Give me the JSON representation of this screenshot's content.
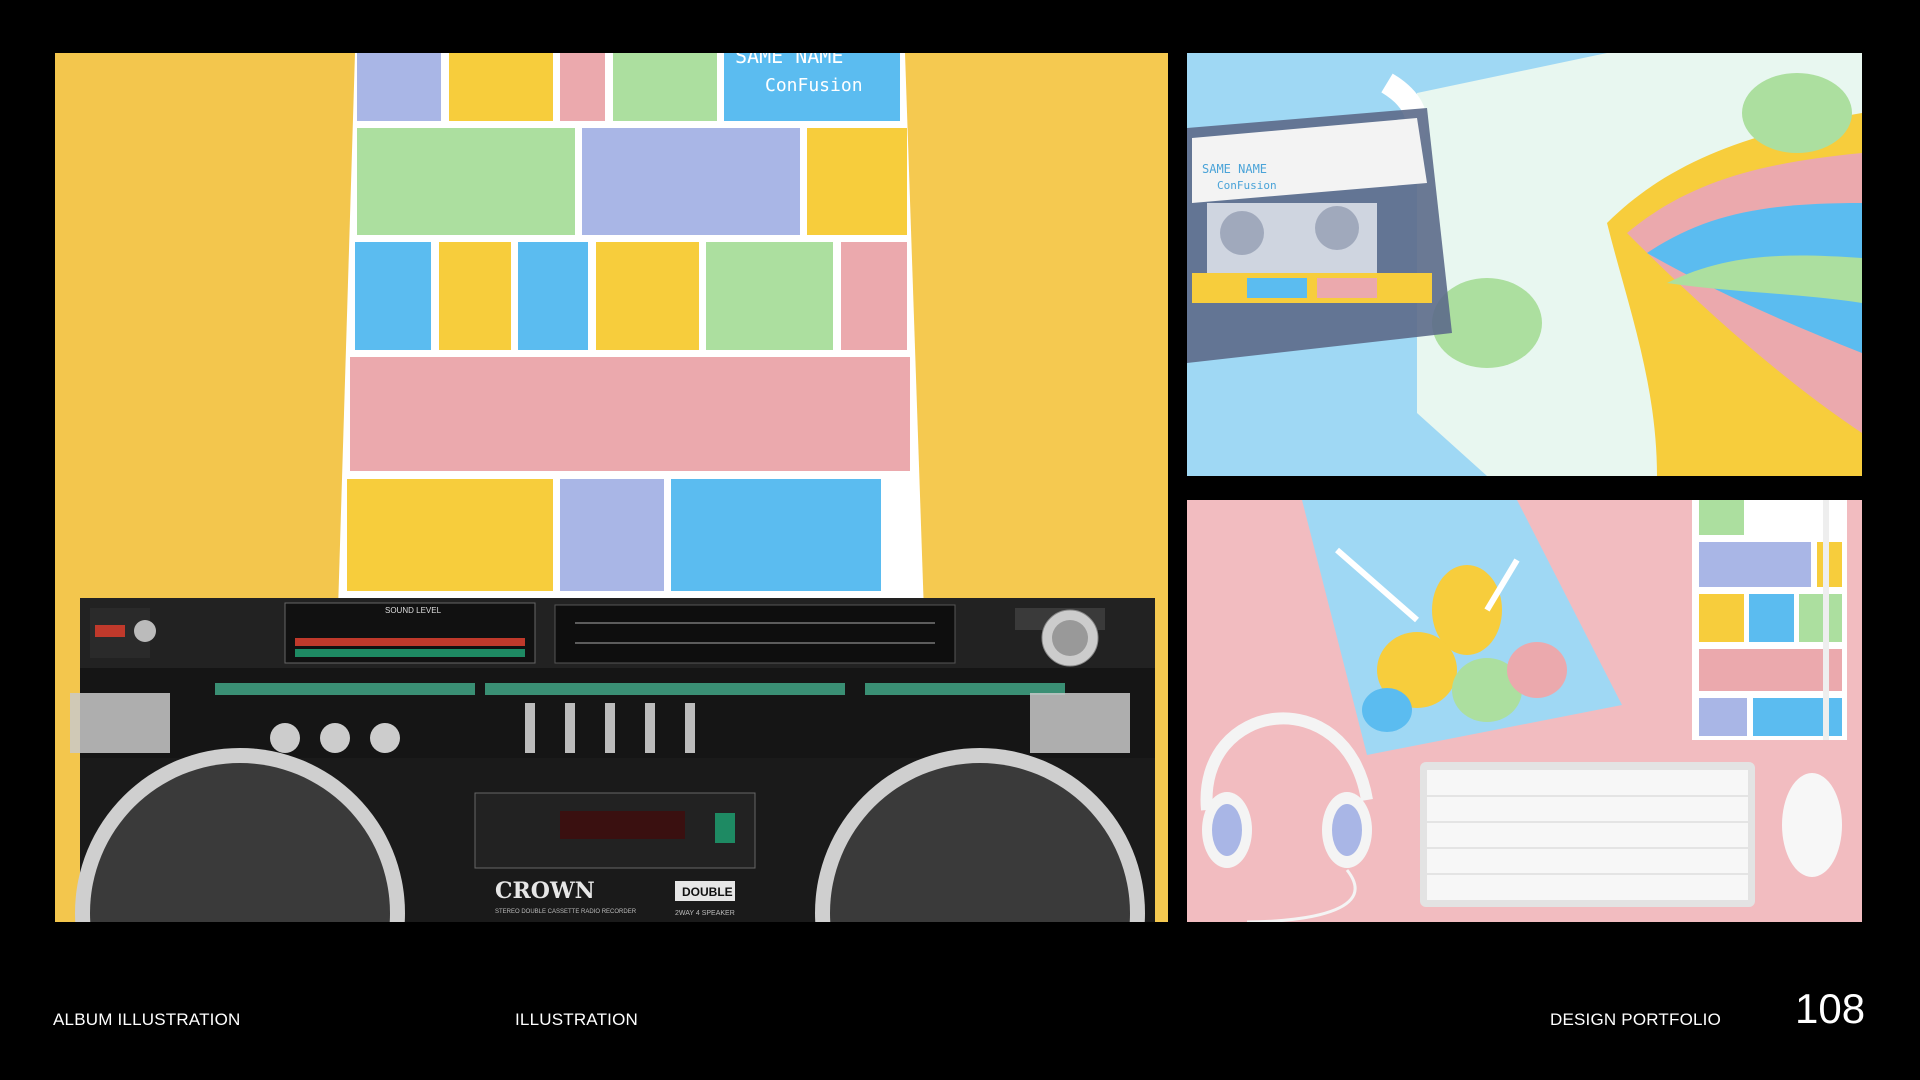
{
  "footer": {
    "left_label": "ALBUM ILLUSTRATION",
    "center_label": "ILLUSTRATION",
    "right_label": "DESIGN PORTFOLIO",
    "page_number": "108"
  },
  "album": {
    "title_line1": "SAME NAME",
    "title_line2": "ConFusion"
  },
  "boombox": {
    "brand": "CROWN",
    "model_badge": "DOUBLE",
    "sub_label": "STEREO DOUBLE CASSETTE RADIO RECORDER",
    "speaker_label": "2WAY 4 SPEAKER",
    "sound_level_label": "SOUND LEVEL"
  },
  "colors": {
    "background": "#000000",
    "wall_yellow": "#f7cd58",
    "sky_blue": "#9fd8f4",
    "pink": "#f2bcc0",
    "tile_blue": "#5bbcf0",
    "tile_green": "#acdf9f",
    "tile_lavender": "#a9b6e6",
    "tile_yellow": "#f7cd3c",
    "tile_pink": "#eba9ad"
  }
}
